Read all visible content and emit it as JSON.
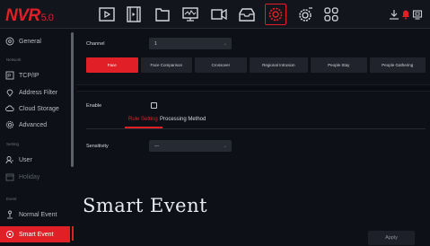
{
  "header": {
    "logo_text": "NVR",
    "logo_version": "5.0",
    "nav_icons": [
      "playback-icon",
      "video-clip-icon",
      "file-icon",
      "monitor-icon",
      "camera-icon",
      "backup-icon",
      "settings-icon",
      "system-gear-icon",
      "grid-icon"
    ],
    "active_nav": "settings-icon",
    "right_icons": [
      "download-icon",
      "alarm-bell-icon",
      "network-icon"
    ],
    "accent_color": "#e01f27"
  },
  "sidebar": {
    "items": [
      {
        "label": "General",
        "icon": "general-settings-icon"
      },
      {
        "section": "Network"
      },
      {
        "label": "TCP/IP",
        "icon": "tcpip-icon"
      },
      {
        "label": "Address Filter",
        "icon": "location-pin-icon"
      },
      {
        "label": "Cloud Storage",
        "icon": "cloud-icon"
      },
      {
        "label": "Advanced",
        "icon": "advanced-gear-icon"
      },
      {
        "section": "Setting"
      },
      {
        "label": "User",
        "icon": "user-icon"
      },
      {
        "label": "Holiday",
        "icon": "calendar-icon",
        "dim": true
      },
      {
        "section": "Event"
      },
      {
        "label": "Normal Event",
        "icon": "normal-event-icon"
      },
      {
        "label": "Smart Event",
        "icon": "smart-event-icon",
        "active": true
      }
    ]
  },
  "main": {
    "channel_label": "Channel",
    "channel_value": "1",
    "tabs": [
      "Face",
      "Face Comparison",
      "Crossover",
      "Regional Intrusion",
      "People Stay",
      "People Gathering"
    ],
    "active_tab": "Face",
    "enable_label": "Enable",
    "enable_checked": false,
    "subtabs": [
      "Rule Setting",
      "Processing Method"
    ],
    "active_subtab": "Rule Setting",
    "sensitivity_label": "Sensitivity",
    "sensitivity_value": "---",
    "overlay_title": "Smart Event",
    "apply_label": "Apply"
  }
}
